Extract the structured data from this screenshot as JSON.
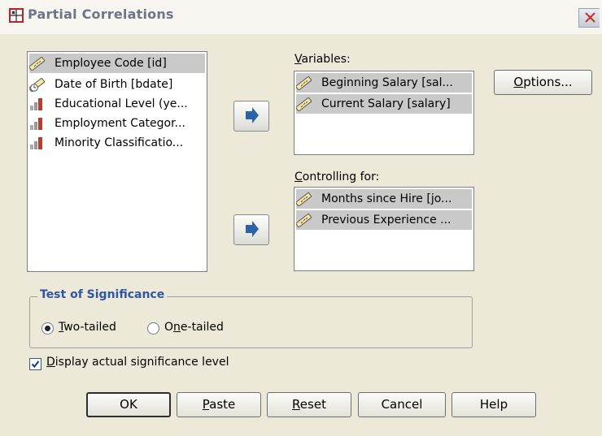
{
  "dialog": {
    "title": "Partial Correlations"
  },
  "source_list": {
    "items": [
      {
        "label": "Employee Code [id]",
        "icon": "scale-ruler-icon",
        "selected": true
      },
      {
        "label": "Date of Birth [bdate]",
        "icon": "date-variable-icon",
        "selected": false
      },
      {
        "label": "Educational Level (ye...",
        "icon": "ordinal-bars-icon",
        "selected": false
      },
      {
        "label": "Employment Categor...",
        "icon": "ordinal-bars-icon",
        "selected": false
      },
      {
        "label": "Minority Classificatio...",
        "icon": "ordinal-bars-icon",
        "selected": false
      }
    ]
  },
  "variables": {
    "label_first": "V",
    "label_rest": "ariables:",
    "items": [
      {
        "label": "Beginning Salary [sal...",
        "icon": "scale-ruler-icon"
      },
      {
        "label": "Current Salary [salary]",
        "icon": "scale-ruler-icon"
      }
    ]
  },
  "controlling": {
    "label_first": "C",
    "label_rest": "ontrolling for:",
    "items": [
      {
        "label": "Months since Hire [jo...",
        "icon": "scale-ruler-icon"
      },
      {
        "label": "Previous Experience ...",
        "icon": "scale-ruler-icon"
      }
    ]
  },
  "options_button": {
    "first": "O",
    "rest": "ptions..."
  },
  "significance": {
    "legend": "Test of Significance",
    "two_tailed": {
      "first": "T",
      "rest": "wo-tailed",
      "checked": true
    },
    "one_tailed": {
      "pre": "O",
      "u": "n",
      "rest": "e-tailed",
      "checked": false
    }
  },
  "display_sig": {
    "first": "D",
    "rest": "isplay actual significance level",
    "checked": true
  },
  "buttons": {
    "ok": "OK",
    "paste_first": "P",
    "paste_rest": "aste",
    "reset_first": "R",
    "reset_rest": "eset",
    "cancel": "Cancel",
    "help": "Help"
  },
  "colors": {
    "selection": "#c9c9c9",
    "group_legend": "#2f55a5",
    "dialog_bg": "#ece9d8"
  }
}
